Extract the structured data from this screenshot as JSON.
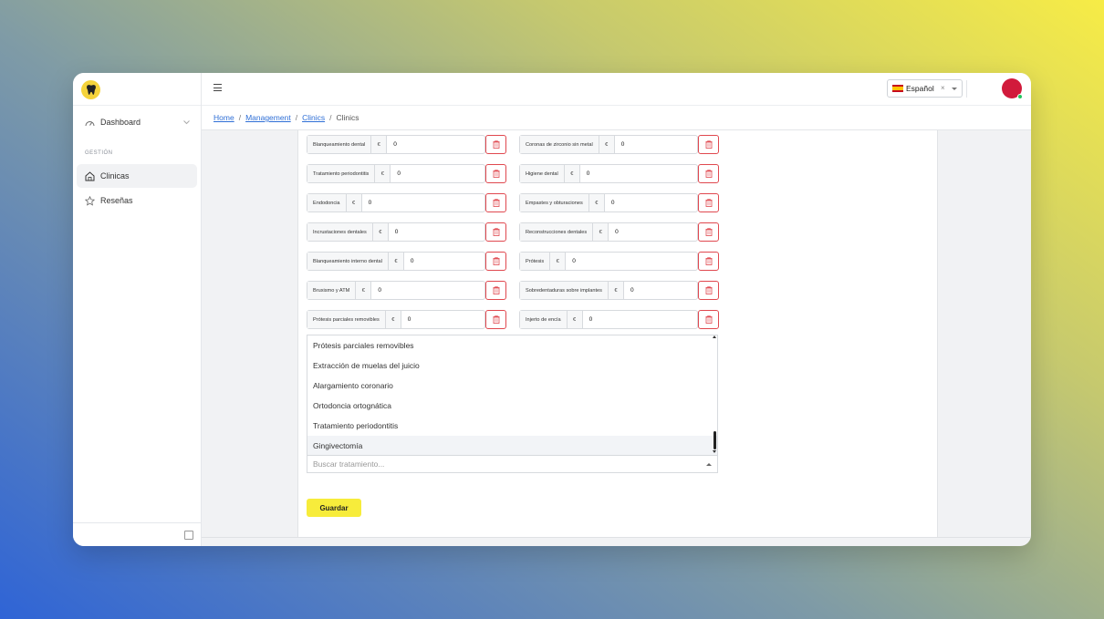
{
  "app": {
    "sidebar": {
      "items": [
        {
          "label": "Dashboard"
        },
        {
          "label": "Clinicas"
        },
        {
          "label": "Reseñas"
        }
      ],
      "section_label": "GESTIÓN"
    },
    "header": {
      "language": "Español"
    },
    "breadcrumb": [
      "Home",
      "Management",
      "Clinics",
      "Clinics"
    ]
  },
  "treatments": {
    "currency": "€",
    "left": [
      {
        "label": "Blanqueamiento dental",
        "value": "0"
      },
      {
        "label": "Tratamiento periodontitis",
        "value": "0"
      },
      {
        "label": "Endodoncia",
        "value": "0"
      },
      {
        "label": "Incrustaciones dentales",
        "value": "0"
      },
      {
        "label": "Blanqueamiento interno dental",
        "value": "0"
      },
      {
        "label": "Bruxismo y ATM",
        "value": "0"
      },
      {
        "label": "Prótesis parciales removibles",
        "value": "0"
      }
    ],
    "right": [
      {
        "label": "Coronas de zirconio sin metal",
        "value": "0"
      },
      {
        "label": "Higiene dental",
        "value": "0"
      },
      {
        "label": "Empastes y obturaciones",
        "value": "0"
      },
      {
        "label": "Reconstrucciones dentales",
        "value": "0"
      },
      {
        "label": "Prótesis",
        "value": "0"
      },
      {
        "label": "Sobredentaduras sobre implantes",
        "value": "0"
      },
      {
        "label": "Injerto de encía",
        "value": "0"
      }
    ]
  },
  "dropdown": {
    "options": [
      "Prótesis parciales removibles",
      "Extracción de muelas del juicio",
      "Alargamiento coronario",
      "Ortodoncia ortognática",
      "Tratamiento periodontitis",
      "Gingivectomía"
    ],
    "highlighted_index": 5,
    "search_placeholder": "Buscar tratamiento..."
  },
  "actions": {
    "save_label": "Guardar"
  },
  "colors": {
    "accent": "#f7ec3b",
    "danger": "#e0484f",
    "link": "#2f6fd6",
    "avatar": "#d11a3b"
  }
}
